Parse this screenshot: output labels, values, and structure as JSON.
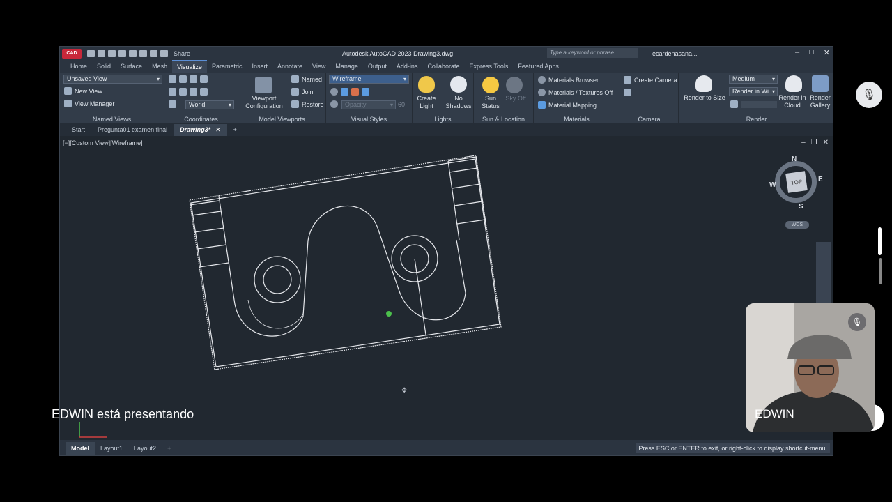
{
  "window": {
    "title": "Autodesk AutoCAD 2023    Drawing3.dwg",
    "app_badge": "CAD",
    "share": "Share",
    "search_placeholder": "Type a keyword or phrase",
    "user": "ecardenasana...",
    "minimize": "–",
    "maximize": "□",
    "close": "✕"
  },
  "ribbon_tabs": [
    "Home",
    "Solid",
    "Surface",
    "Mesh",
    "Visualize",
    "Parametric",
    "Insert",
    "Annotate",
    "View",
    "Manage",
    "Output",
    "Add-ins",
    "Collaborate",
    "Express Tools",
    "Featured Apps"
  ],
  "ribbon": {
    "named_views": {
      "dropdown": "Unsaved View",
      "new_view": "New View",
      "view_manager": "View Manager",
      "label": "Named Views"
    },
    "coordinates": {
      "dropdown": "World",
      "label": "Coordinates"
    },
    "model_viewports": {
      "config": "Viewport\nConfiguration",
      "named": "Named",
      "join": "Join",
      "restore": "Restore",
      "label": "Model Viewports"
    },
    "visual_styles": {
      "dropdown": "Wireframe",
      "opacity": "Opacity",
      "opacity_value": "60",
      "label": "Visual Styles"
    },
    "lights": {
      "create_light": "Create\nLight",
      "no_shadows": "No\nShadows",
      "label": "Lights"
    },
    "sun_location": {
      "sun_status": "Sun\nStatus",
      "sky_off": "Sky Off",
      "label": "Sun & Location"
    },
    "materials": {
      "browser": "Materials Browser",
      "textures": "Materials / Textures Off",
      "mapping": "Material Mapping",
      "label": "Materials"
    },
    "camera": {
      "create_camera": "Create Camera",
      "label": "Camera"
    },
    "render": {
      "render_to_size": "Render to Size",
      "quality": "Medium",
      "render_in": "Render in Wi...",
      "render_in_cloud": "Render in\nCloud",
      "render_gallery": "Render\nGallery",
      "label": "Render"
    }
  },
  "file_tabs": {
    "start": "Start",
    "tab1": "Pregunta01 examen final",
    "tab2": "Drawing3*",
    "close": "✕",
    "add": "+"
  },
  "viewport": {
    "label": "[−][Custom View][Wireframe]",
    "viewcube": {
      "top": "TOP",
      "n": "N",
      "s": "S",
      "e": "E",
      "w": "W",
      "wcs": "WCS"
    }
  },
  "layout_tabs": {
    "model": "Model",
    "layout1": "Layout1",
    "layout2": "Layout2",
    "add": "+"
  },
  "status_message": "Press ESC or ENTER to exit, or right-click to display shortcut-menu.",
  "meeting": {
    "presenting": "EDWIN está presentando",
    "participant_name": "EDWIN"
  }
}
